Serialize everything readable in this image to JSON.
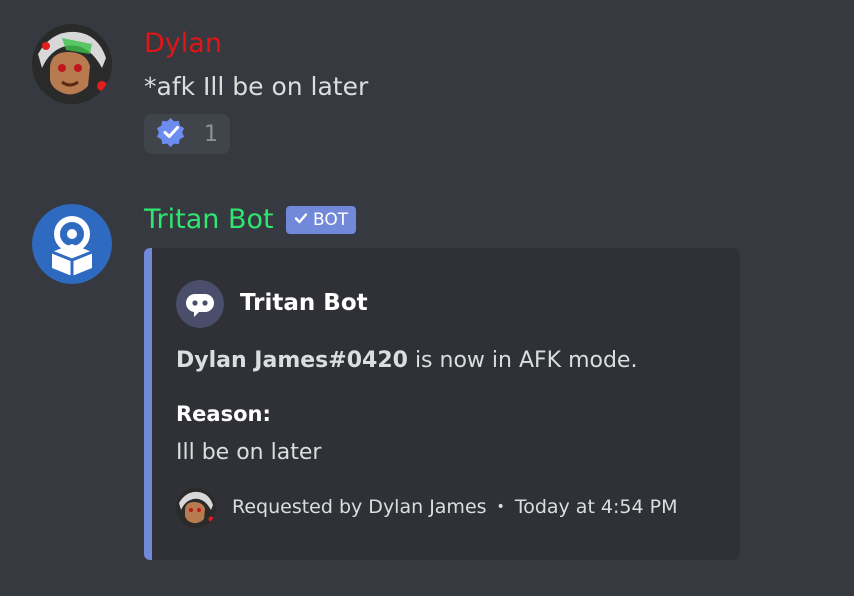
{
  "messages": [
    {
      "author": "Dylan",
      "author_color": "#e01515",
      "content": "*afk Ill be on later",
      "reaction": {
        "emoji": "verified-check-badge-icon",
        "count": "1"
      }
    },
    {
      "author": "Tritan Bot",
      "author_color": "#2ee670",
      "badge": "BOT",
      "embed": {
        "color": "#7289da",
        "author_name": "Tritan Bot",
        "description_bold": "Dylan James#0420",
        "description_rest": " is now in AFK mode.",
        "field_name": "Reason:",
        "field_value": "Ill be on later",
        "footer_text": "Requested by Dylan James",
        "footer_separator": "•",
        "footer_timestamp": "Today at 4:54 PM"
      }
    }
  ]
}
